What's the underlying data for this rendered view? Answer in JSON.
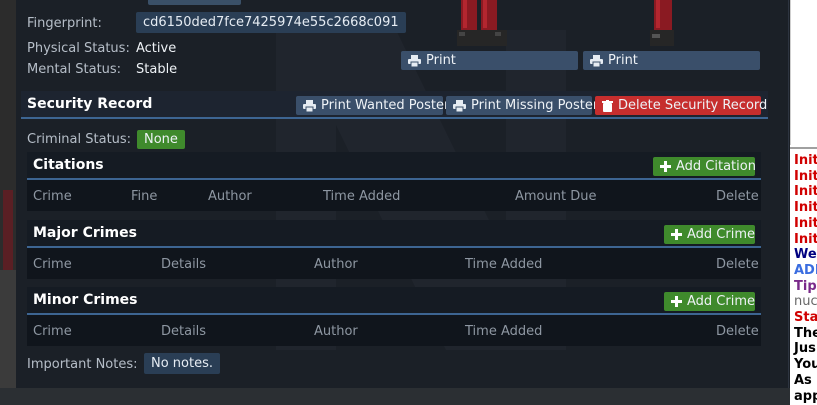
{
  "identity": {
    "fingerprint_label": "Fingerprint:",
    "fingerprint_value": "cd6150ded7fce7425974e55c2668c091",
    "physical_label": "Physical Status:",
    "physical_value": "Active",
    "mental_label": "Mental Status:",
    "mental_value": "Stable",
    "print_buttons": [
      "Print",
      "Print"
    ]
  },
  "security": {
    "title": "Security Record",
    "buttons": {
      "wanted": "Print Wanted Poster",
      "missing": "Print Missing Poster",
      "delete": "Delete Security Record"
    },
    "criminal_status_label": "Criminal Status:",
    "criminal_status_value": "None"
  },
  "citations": {
    "title": "Citations",
    "add_label": "Add Citation",
    "columns": [
      "Crime",
      "Fine",
      "Author",
      "Time Added",
      "Amount Due",
      "Delete"
    ]
  },
  "major": {
    "title": "Major Crimes",
    "add_label": "Add Crime",
    "columns": [
      "Crime",
      "Details",
      "Author",
      "Time Added",
      "Delete"
    ]
  },
  "minor": {
    "title": "Minor Crimes",
    "add_label": "Add Crime",
    "columns": [
      "Crime",
      "Details",
      "Author",
      "Time Added",
      "Delete"
    ]
  },
  "notes": {
    "label": "Important Notes:",
    "value": "No notes."
  },
  "chat": {
    "lines": [
      {
        "text": "Init",
        "color": "#d00000"
      },
      {
        "text": "Init",
        "color": "#d00000"
      },
      {
        "text": "Init",
        "color": "#d00000"
      },
      {
        "text": "Init",
        "color": "#d00000"
      },
      {
        "text": "Init",
        "color": "#d00000"
      },
      {
        "text": "Init",
        "color": "#d00000"
      },
      {
        "text": "We",
        "color": "#000080"
      },
      {
        "text": "ADI",
        "color": "#3a6de0"
      },
      {
        "text": "Tip",
        "color": "#7a2a8a"
      },
      {
        "text": "nuc",
        "color": "#666666"
      },
      {
        "text": "Sta",
        "color": "#d00000"
      },
      {
        "text": "The",
        "color": "#000000"
      },
      {
        "text": "Jus",
        "color": "#000000"
      },
      {
        "text": "You",
        "color": "#000000"
      },
      {
        "text": "As",
        "color": "#000000"
      },
      {
        "text": "app",
        "color": "#000000"
      }
    ]
  },
  "colors": {
    "accent": "#3d6592",
    "green": "#3f8a2c",
    "red": "#c62e2e",
    "panel": "#1b2027"
  }
}
